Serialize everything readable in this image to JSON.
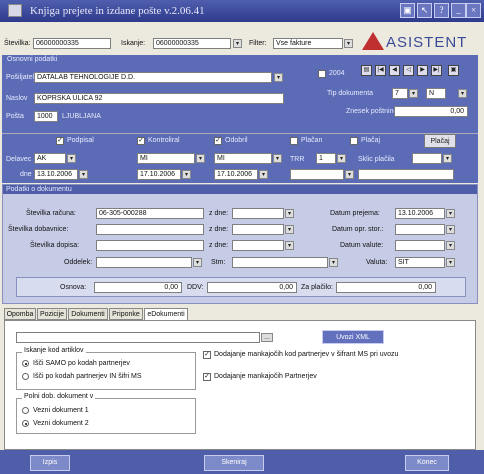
{
  "window": {
    "title": "Knjiga prejete in izdane pošte v.2.06.41"
  },
  "toolbar": {
    "stevilka_label": "Številka:",
    "stevilka_value": "06000000335",
    "iskanje_label": "Iskanje:",
    "iskanje_value": "06000000335",
    "filter_label": "Filter:",
    "filter_value": "Vse fakture",
    "logo": "ASISTENT"
  },
  "osnovni": {
    "title": "Osnovni podatki",
    "posiljatelj_label": "Pošiljatelj",
    "posiljatelj": "DATALAB TEHNOLOGIJE D.D.",
    "naslov_label": "Naslov",
    "naslov": "KOPRSKA ULICA 92",
    "posta_label": "Pošta",
    "posta": "1000",
    "kraj": "LJUBLJANA",
    "year": "2004",
    "tip_label": "Tip dokumenta",
    "tip_value": "7",
    "tip_value2": "N",
    "znesek_label": "Znesek poštnine",
    "znesek": "0,00"
  },
  "status": {
    "podpisal": "Podpisal",
    "kontroliral": "Kontroliral",
    "odobril": "Odobril",
    "placan": "Plačan",
    "placaj_cb": "Plačaj",
    "placaj_btn": "Plačaj",
    "delavec_label": "Delavec",
    "delavec": [
      "AK",
      "MI",
      "MI"
    ],
    "dne_label": "dne",
    "dne": [
      "13.10.2006",
      "17.10.2006",
      "17.10.2006"
    ],
    "trr_label": "TRR",
    "trr_value": "1",
    "sklic_label": "Sklic plačila"
  },
  "podatki": {
    "title": "Podatki o dokumentu",
    "stevilka_racuna_label": "Številka računa:",
    "stevilka_racuna": "06-305-000288",
    "z_dne": "z dne:",
    "datum_prejema_label": "Datum prejema:",
    "datum_prejema": "13.10.2006",
    "stevilka_dobavnice_label": "Številka dobavnice:",
    "datum_opr_label": "Datum opr. stor.:",
    "stevilka_dopisa_label": "Številka dopisa:",
    "datum_valute_label": "Datum valute:",
    "oddelek_label": "Oddelek:",
    "stm_label": "Stm:",
    "valuta_label": "Valuta:",
    "valuta": "SIT",
    "osnova_label": "Osnova:",
    "osnova": "0,00",
    "ddv_label": "DDV:",
    "ddv": "0,00",
    "zaplacilo_label": "Za plačilo:",
    "zaplacilo": "0,00"
  },
  "tabs": [
    "Opomba",
    "Pozicije",
    "Dokumenti",
    "Priponke",
    "eDokumenti"
  ],
  "edok": {
    "uvozi": "Uvozi XML",
    "iskanje_title": "Iskanje kod artiklov",
    "r1": "Išči SAMO po kodah partnerjev",
    "r2": "Išči po kodah partnerjev IN šifri MS",
    "polni_title": "Polni dob. dokument v",
    "r3": "Vezni dokument 1",
    "r4": "Vezni dokument 2",
    "cb1": "Dodajanje mankajočih kod partnerjev v šifrant MS pri uvozu",
    "cb2": "Dodajanje mankajočih Partnerjev"
  },
  "footer": {
    "izpis": "Izpis",
    "skeniraj": "Skeniraj",
    "konec": "Konec"
  }
}
